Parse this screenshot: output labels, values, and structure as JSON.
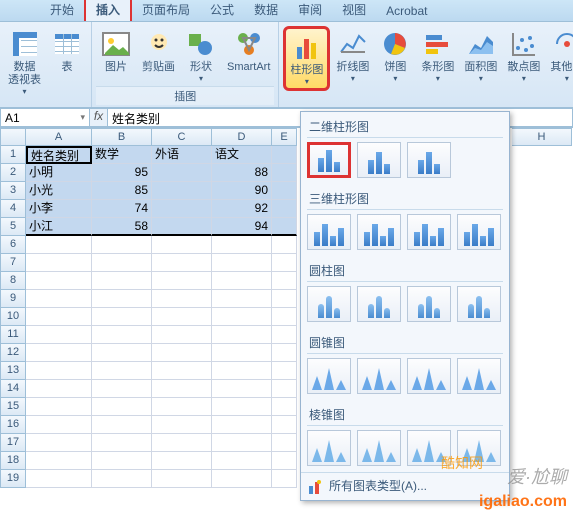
{
  "tabs": [
    "开始",
    "插入",
    "页面布局",
    "公式",
    "数据",
    "审阅",
    "视图",
    "Acrobat"
  ],
  "active_tab_index": 1,
  "ribbon": {
    "groups": [
      {
        "label": "",
        "buttons": [
          {
            "name": "pivottable-button",
            "label": "数据\n透视表",
            "dd": true
          },
          {
            "name": "table-button",
            "label": "表",
            "dd": false
          }
        ]
      },
      {
        "label": "插图",
        "buttons": [
          {
            "name": "picture-button",
            "label": "图片",
            "dd": false
          },
          {
            "name": "clipart-button",
            "label": "剪贴画",
            "dd": false
          },
          {
            "name": "shapes-button",
            "label": "形状",
            "dd": true
          },
          {
            "name": "smartart-button",
            "label": "SmartArt",
            "dd": false
          }
        ]
      },
      {
        "label": "",
        "buttons": [
          {
            "name": "column-chart-button",
            "label": "柱形图",
            "dd": true,
            "highlight": true
          },
          {
            "name": "line-chart-button",
            "label": "折线图",
            "dd": true
          },
          {
            "name": "pie-chart-button",
            "label": "饼图",
            "dd": true
          },
          {
            "name": "bar-chart-button",
            "label": "条形图",
            "dd": true
          },
          {
            "name": "area-chart-button",
            "label": "面积图",
            "dd": true
          },
          {
            "name": "scatter-chart-button",
            "label": "散点图",
            "dd": true
          },
          {
            "name": "other-chart-button",
            "label": "其他图",
            "dd": true
          }
        ]
      }
    ]
  },
  "namebox": "A1",
  "formula": "姓名类别",
  "columns": [
    "A",
    "B",
    "C",
    "D",
    "E",
    "H"
  ],
  "row_count": 19,
  "chart_data": {
    "type": "table",
    "headers": [
      "姓名类别",
      "数学",
      "外语",
      "语文"
    ],
    "rows": [
      [
        "小明",
        95,
        "",
        88
      ],
      [
        "小光",
        85,
        "",
        90
      ],
      [
        "小李",
        74,
        "",
        92
      ],
      [
        "小江",
        58,
        "",
        94
      ]
    ]
  },
  "chart_panel": {
    "sections": [
      {
        "title": "二维柱形图",
        "count": 3,
        "highlight_index": 0,
        "kind": "flat"
      },
      {
        "title": "三维柱形图",
        "count": 4,
        "kind": "3d"
      },
      {
        "title": "圆柱图",
        "count": 4,
        "kind": "cyl"
      },
      {
        "title": "圆锥图",
        "count": 4,
        "kind": "cone"
      },
      {
        "title": "棱锥图",
        "count": 4,
        "kind": "pyr"
      }
    ],
    "footer": "所有图表类型(A)..."
  },
  "watermarks": {
    "a": "爱·尬聊",
    "b": "igaliao.com",
    "c": "酷知网"
  }
}
